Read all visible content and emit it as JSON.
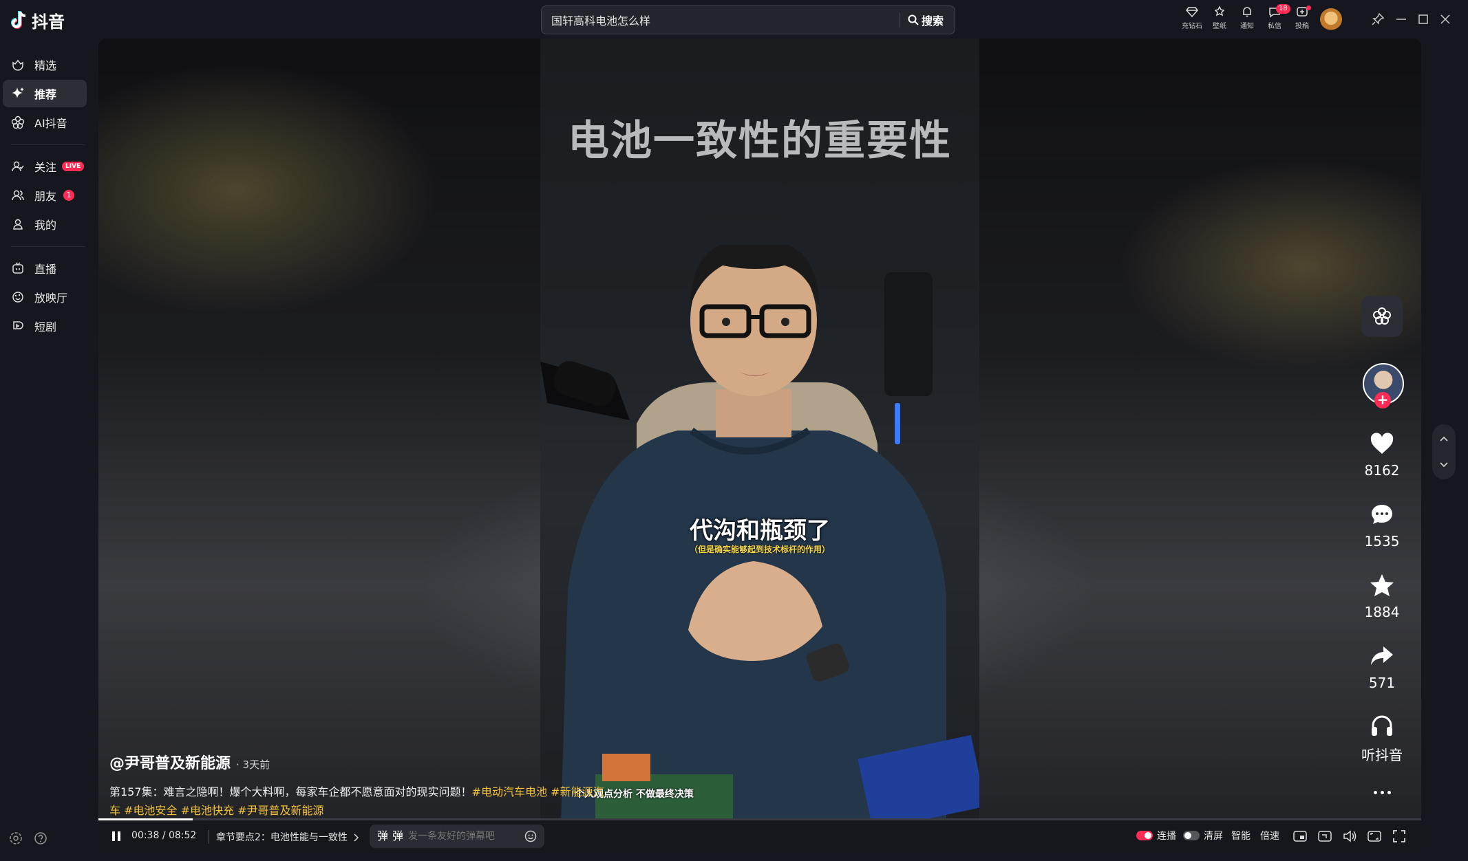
{
  "app": {
    "name": "抖音"
  },
  "search": {
    "value": "国轩高科电池怎么样",
    "button_label": "搜索"
  },
  "toolbar": [
    {
      "label": "充钻石",
      "icon": "diamond-icon"
    },
    {
      "label": "壁纸",
      "icon": "pin-star-icon"
    },
    {
      "label": "通知",
      "icon": "bell-icon"
    },
    {
      "label": "私信",
      "icon": "message-icon",
      "badge": "18"
    },
    {
      "label": "投稿",
      "icon": "upload-icon",
      "dot": true
    }
  ],
  "sidebar": {
    "items": [
      {
        "label": "精选",
        "icon": "featured-icon"
      },
      {
        "label": "推荐",
        "icon": "sparkle-icon",
        "active": true
      },
      {
        "label": "AI抖音",
        "icon": "ai-flower-icon"
      },
      {
        "label": "关注",
        "icon": "follow-icon",
        "badge": "LIVE"
      },
      {
        "label": "朋友",
        "icon": "friends-icon",
        "badge": "1"
      },
      {
        "label": "我的",
        "icon": "user-icon"
      },
      {
        "label": "直播",
        "icon": "tv-icon"
      },
      {
        "label": "放映厅",
        "icon": "theater-icon"
      },
      {
        "label": "短剧",
        "icon": "short-drama-icon"
      }
    ]
  },
  "video": {
    "overlay_title": "电池一致性的重要性",
    "subtitle": "代沟和瓶颈了",
    "subtitle_small": "（但是确实能够起到技术标杆的作用）",
    "disclaimer": "个人观点分析 不做最终决策",
    "author": "@尹哥普及新能源",
    "posted": "· 3天前",
    "description": "第157集：难言之隐啊！爆个大料啊，每家车企都不愿意面对的现实问题！",
    "tags": [
      "#电动汽车电池",
      "#新能源汽车",
      "#电池安全",
      "#电池快充",
      "#尹哥普及新能源"
    ]
  },
  "rail": {
    "likes": "8162",
    "comments": "1535",
    "favorites": "1884",
    "shares": "571",
    "listen_label": "听抖音"
  },
  "controls": {
    "current_time": "00:38",
    "separator": "/",
    "duration": "08:52",
    "progress": 0.0714,
    "chapter": "章节要点2：电池性能与一致性",
    "danmaku_placeholder": "发一条友好的弹幕吧",
    "autoplay_label": "连播",
    "clear_label": "清屏",
    "smart_label": "智能",
    "speed_label": "倍速"
  },
  "colors": {
    "accent": "#fe2c55",
    "tag": "#f5c33b",
    "background": "#16171e"
  }
}
